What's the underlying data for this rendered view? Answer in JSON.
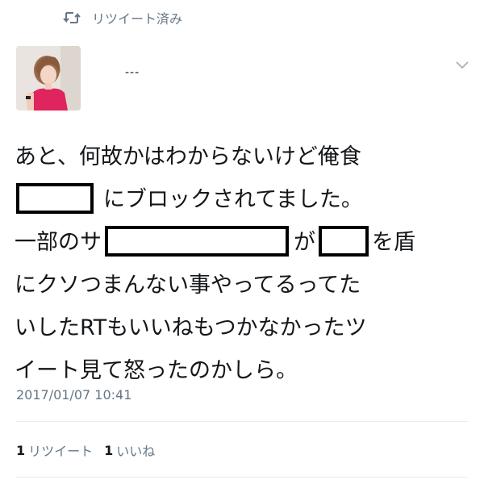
{
  "retweet_context": {
    "icon": "retweet-icon",
    "label": "リツイート済み"
  },
  "author": {
    "avatar": "profile-photo",
    "name": "---"
  },
  "tweet": {
    "lines": [
      {
        "text": "あと、何故かはわからないけど俺食"
      },
      {
        "after_redaction": "にブロックされてました。"
      },
      {
        "before": "一部のサ",
        "middle": "が",
        "after": "を盾"
      },
      {
        "text": "にクソつまんない事やってるってた"
      },
      {
        "text": "いしたRTもいいねもつかなかったツ"
      },
      {
        "text": "イート見て怒ったのかしら。"
      }
    ],
    "timestamp": "2017/01/07 10:41"
  },
  "stats": {
    "retweets_count": "1",
    "retweets_label": "リツイート",
    "likes_count": "1",
    "likes_label": "いいね"
  },
  "colors": {
    "text": "#14171a",
    "secondary": "#657786",
    "divider": "#e6ecf0",
    "avatar_shirt": "#e0245e"
  }
}
